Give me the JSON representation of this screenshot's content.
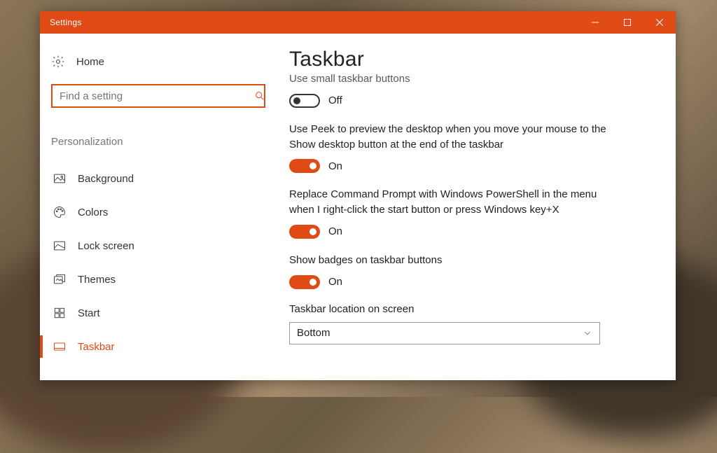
{
  "window": {
    "title": "Settings"
  },
  "sidebar": {
    "home": "Home",
    "search_placeholder": "Find a setting",
    "section": "Personalization",
    "items": [
      {
        "label": "Background",
        "icon": "image-icon"
      },
      {
        "label": "Colors",
        "icon": "palette-icon"
      },
      {
        "label": "Lock screen",
        "icon": "lockscreen-icon"
      },
      {
        "label": "Themes",
        "icon": "themes-icon"
      },
      {
        "label": "Start",
        "icon": "start-icon"
      },
      {
        "label": "Taskbar",
        "icon": "taskbar-icon"
      }
    ],
    "active_index": 5
  },
  "main": {
    "title": "Taskbar",
    "options": [
      {
        "label": "Use small taskbar buttons",
        "state": "Off",
        "on": false,
        "truncated": true
      },
      {
        "label": "Use Peek to preview the desktop when you move your mouse to the Show desktop button at the end of the taskbar",
        "state": "On",
        "on": true
      },
      {
        "label": "Replace Command Prompt with Windows PowerShell in the menu when I right-click the start button or press Windows key+X",
        "state": "On",
        "on": true
      },
      {
        "label": "Show badges on taskbar buttons",
        "state": "On",
        "on": true
      }
    ],
    "dropdown": {
      "label": "Taskbar location on screen",
      "value": "Bottom"
    }
  },
  "colors": {
    "accent": "#e04b15"
  }
}
